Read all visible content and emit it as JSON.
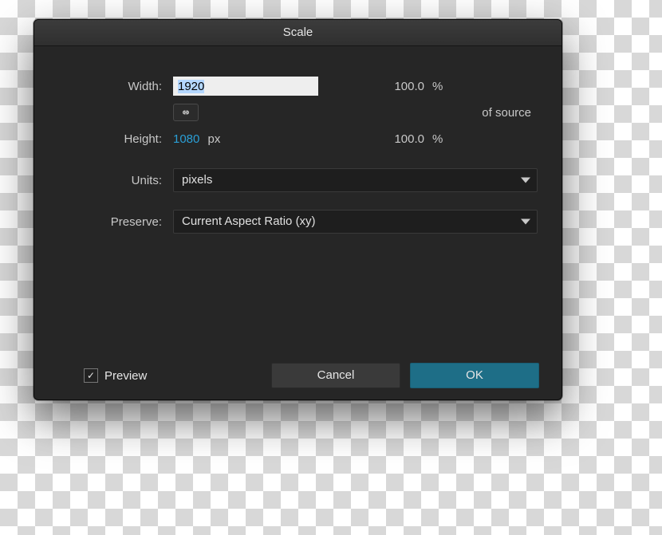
{
  "title": "Scale",
  "width": {
    "label": "Width:",
    "value": "1920",
    "percent": "100.0"
  },
  "height": {
    "label": "Height:",
    "value": "1080",
    "unit": "px",
    "percent": "100.0"
  },
  "percent_symbol": "%",
  "of_source": "of source",
  "units": {
    "label": "Units:",
    "value": "pixels"
  },
  "preserve": {
    "label": "Preserve:",
    "value": "Current Aspect Ratio (xy)"
  },
  "preview_label": "Preview",
  "buttons": {
    "cancel": "Cancel",
    "ok": "OK"
  }
}
